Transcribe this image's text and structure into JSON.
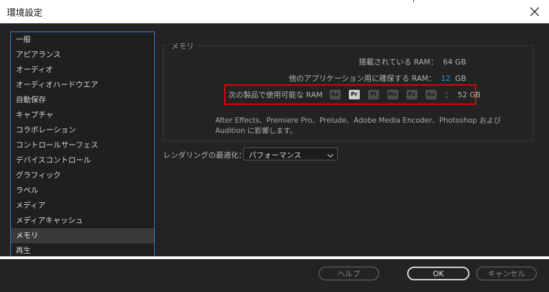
{
  "window": {
    "title": "環境設定",
    "close_icon": "close-icon"
  },
  "sidebar": {
    "items": [
      {
        "label": "一般"
      },
      {
        "label": "アピアランス"
      },
      {
        "label": "オーディオ"
      },
      {
        "label": "オーディオハードウエア"
      },
      {
        "label": "自動保存"
      },
      {
        "label": "キャプチャ"
      },
      {
        "label": "コラボレーション"
      },
      {
        "label": "コントロールサーフェス"
      },
      {
        "label": "デバイスコントロール"
      },
      {
        "label": "グラフィック"
      },
      {
        "label": "ラベル"
      },
      {
        "label": "メディア"
      },
      {
        "label": "メディアキャッシュ"
      },
      {
        "label": "メモリ",
        "selected": true
      },
      {
        "label": "再生"
      }
    ]
  },
  "memory": {
    "legend": "メモリ",
    "installed_label": "搭載されている RAM：",
    "installed_value": "64 GB",
    "reserved_label": "他のアプリケーション用に確保する RAM：",
    "reserved_value": "12",
    "reserved_unit": "GB",
    "available_label": "次の製品で使用可能な RAM",
    "products": [
      "Ae",
      "Pr",
      "Pl",
      "Me",
      "Ps",
      "Au"
    ],
    "active_product": "Pr",
    "available_separator": "：",
    "available_value": "52 GB",
    "note": "After Effects、Premiere Pro、Prelude、Adobe Media Encoder、Photoshop および Audition に影響します。"
  },
  "render": {
    "label": "レンダリングの最適化：",
    "selected": "パフォーマンス"
  },
  "footer": {
    "help_label": "ヘルプ",
    "ok_label": "OK",
    "cancel_label": "キャンセル"
  },
  "colors": {
    "accent_blue": "#2e8fe6",
    "highlight_red": "#e0000d",
    "panel": "#232323"
  }
}
